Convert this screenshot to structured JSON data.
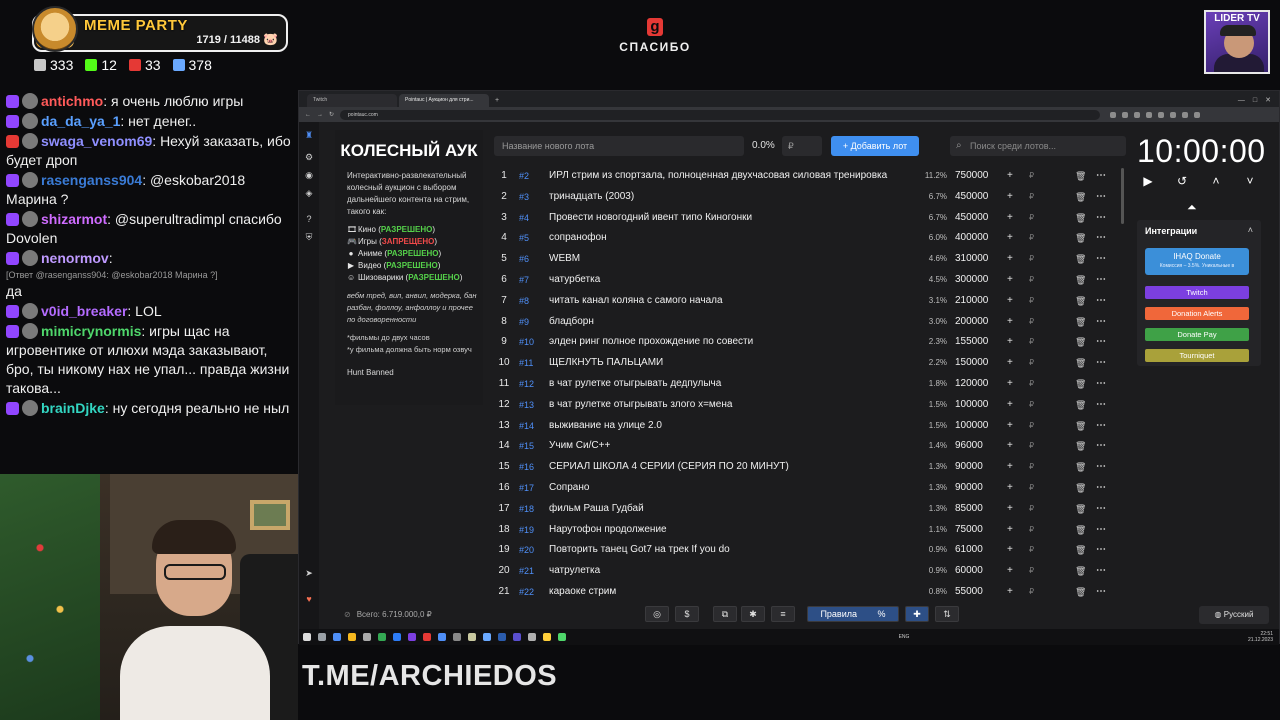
{
  "overlay": {
    "meme_title": "MEME PARTY",
    "meme_count": "1719 / 11488",
    "meme_fill_fraction": 0.15,
    "stats": [
      {
        "icon": "viewers-icon",
        "value": "333",
        "color": "#c8c8c8"
      },
      {
        "icon": "kick-icon",
        "value": "12",
        "color": "#53fc18"
      },
      {
        "icon": "live-icon",
        "value": "33",
        "color": "#e53935"
      },
      {
        "icon": "user-icon",
        "value": "378",
        "color": "#6aa9ff"
      }
    ],
    "center_logo": "g",
    "center_text": "СПАСИБО",
    "lider_title": "LIDER TV",
    "tme": "T.ME/ARCHIEDOS"
  },
  "chat": [
    {
      "user": "antichmo",
      "color": "#ff5a5a",
      "text": ": я очень люблю игры"
    },
    {
      "user": "da_da_ya_1",
      "color": "#5aa0ff",
      "text": ": нет денег.."
    },
    {
      "user": "swaga_venom69",
      "color": "#8f8fff",
      "text": ": Нехуй заказать, ибо будет дроп"
    },
    {
      "user": "rasenganss904",
      "color": "#3a7bd5",
      "text": ": @eskobar2018 Марина ?"
    },
    {
      "user": "shizarmot",
      "color": "#cf6cff",
      "text": ": @superultradimpl спасибо Dovolen"
    },
    {
      "user": "nenormov",
      "color": "#bf9aff",
      "text": ":"
    },
    {
      "reply": "[Ответ @rasenganss904: @eskobar2018 Марина ?]",
      "text": "да"
    },
    {
      "user": "v0id_breaker",
      "color": "#b46cff",
      "text": ": LOL"
    },
    {
      "user": "mimicrynormis",
      "color": "#4fd66b",
      "text": ": игры щас на игровентике от илюхи мэда заказывают, бро, ты никому нах не упал... правда жизни такова..."
    },
    {
      "user": "brainDjke",
      "color": "#33d6c2",
      "text": ": ну сегодня реально не ныл"
    }
  ],
  "browser": {
    "tabs": [
      "Twitch",
      "Pointauc | Аукцион для стри..."
    ],
    "url": "pointauc.com"
  },
  "info": {
    "title": "КОЛЕСНЫЙ АУК",
    "desc": "Интерактивно-развлекательный колесный аукцион с выбором дальнейшего контента на стрим, такого как:",
    "list": [
      {
        "icon": "film-icon",
        "name": "Кино",
        "status": "РАЗРЕШЕНО",
        "ok": true
      },
      {
        "icon": "gamepad-icon",
        "name": "Игры",
        "status": "ЗАПРЕЩЕНО",
        "ok": false
      },
      {
        "icon": "anime-icon",
        "name": "Аниме",
        "status": "РАЗРЕШЕНО",
        "ok": true
      },
      {
        "icon": "video-icon",
        "name": "Видео",
        "status": "РАЗРЕШЕНО",
        "ok": true
      },
      {
        "icon": "emoji-icon",
        "name": "Шизоварики",
        "status": "РАЗРЕШЕНО",
        "ok": true
      }
    ],
    "note": "вебм тред, вип, анвил, модерка, бан разбан, фоллоу, анфоллоу и прочее по договоренности",
    "note2": "*фильмы до двух часов\n*у фильма должна быть норм озвуч",
    "hunt": "Hunt Banned"
  },
  "lot_form": {
    "name_placeholder": "Название нового лота",
    "pct": "0.0%",
    "amount_placeholder": "₽",
    "add_label": "Добавить лот",
    "search_placeholder": "Поиск среди лотов..."
  },
  "lots": [
    {
      "n": "1",
      "id": "#2",
      "name": "ИРЛ стрим из спортзала, полноценная двухчасовая силовая тренировка",
      "pct": "11.2%",
      "amount": "750000"
    },
    {
      "n": "2",
      "id": "#3",
      "name": "тринадцать (2003)",
      "pct": "6.7%",
      "amount": "450000"
    },
    {
      "n": "3",
      "id": "#4",
      "name": "Провести новогодний ивент типо Киногонки",
      "pct": "6.7%",
      "amount": "450000"
    },
    {
      "n": "4",
      "id": "#5",
      "name": "сопранофон",
      "pct": "6.0%",
      "amount": "400000"
    },
    {
      "n": "5",
      "id": "#6",
      "name": "WEBM",
      "pct": "4.6%",
      "amount": "310000"
    },
    {
      "n": "6",
      "id": "#7",
      "name": "чатурбетка",
      "pct": "4.5%",
      "amount": "300000"
    },
    {
      "n": "7",
      "id": "#8",
      "name": "читать канал коляна с самого начала",
      "pct": "3.1%",
      "amount": "210000"
    },
    {
      "n": "8",
      "id": "#9",
      "name": "бладборн",
      "pct": "3.0%",
      "amount": "200000"
    },
    {
      "n": "9",
      "id": "#10",
      "name": "элден ринг полное прохождение по совести",
      "pct": "2.3%",
      "amount": "155000"
    },
    {
      "n": "10",
      "id": "#11",
      "name": "ЩЕЛКНУТЬ ПАЛЬЦАМИ",
      "pct": "2.2%",
      "amount": "150000"
    },
    {
      "n": "11",
      "id": "#12",
      "name": "в чат рулетке отыгрывать дедпулыча",
      "pct": "1.8%",
      "amount": "120000"
    },
    {
      "n": "12",
      "id": "#13",
      "name": "в чат рулетке отыгрывать злого х=мена",
      "pct": "1.5%",
      "amount": "100000"
    },
    {
      "n": "13",
      "id": "#14",
      "name": "выживание на улице 2.0",
      "pct": "1.5%",
      "amount": "100000"
    },
    {
      "n": "14",
      "id": "#15",
      "name": "Учим Си/С++",
      "pct": "1.4%",
      "amount": "96000"
    },
    {
      "n": "15",
      "id": "#16",
      "name": "СЕРИАЛ ШКОЛА 4 СЕРИИ (СЕРИЯ ПО 20 МИНУТ)",
      "pct": "1.3%",
      "amount": "90000"
    },
    {
      "n": "16",
      "id": "#17",
      "name": "Сопрано",
      "pct": "1.3%",
      "amount": "90000"
    },
    {
      "n": "17",
      "id": "#18",
      "name": "фильм Раша Гудбай",
      "pct": "1.3%",
      "amount": "85000"
    },
    {
      "n": "18",
      "id": "#19",
      "name": "Нарутофон продолжение",
      "pct": "1.1%",
      "amount": "75000"
    },
    {
      "n": "19",
      "id": "#20",
      "name": "Повторить танец Got7 на трек If you do",
      "pct": "0.9%",
      "amount": "61000"
    },
    {
      "n": "20",
      "id": "#21",
      "name": "чатрулетка",
      "pct": "0.9%",
      "amount": "60000"
    },
    {
      "n": "21",
      "id": "#22",
      "name": "караоке стрим",
      "pct": "0.8%",
      "amount": "55000"
    }
  ],
  "timer": {
    "value": "10:00:00"
  },
  "integrations": {
    "title": "Интеграции",
    "ihaq_title": "IHAQ Donate",
    "ihaq_sub": "Комиссия – 3.5%. Уникальные в",
    "buttons": [
      {
        "label": "Twitch",
        "color": "#7c3fe0"
      },
      {
        "label": "Donation Alerts",
        "color": "#f0673a"
      },
      {
        "label": "Donate Pay",
        "color": "#3fa147"
      },
      {
        "label": "Tourniquet",
        "color": "#a9a13a"
      }
    ]
  },
  "footer": {
    "total": "Всего: 6.719.000,0 ₽",
    "rules": "Правила",
    "pct_sign": "%",
    "lang": "Русский"
  },
  "taskbar": {
    "lang": "ENG",
    "time": "22:51",
    "date": "21.12.2023"
  }
}
